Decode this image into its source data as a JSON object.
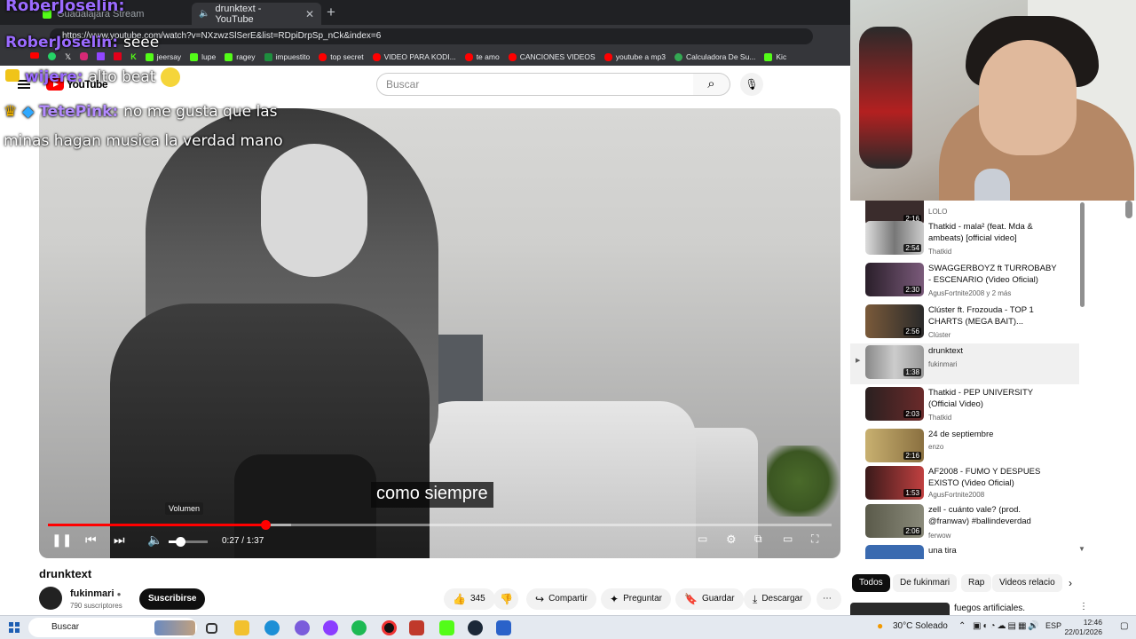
{
  "browser": {
    "tabs": [
      {
        "label": "Guadalajara Stream",
        "active": false
      },
      {
        "label": "drunktext - YouTube",
        "active": true
      }
    ],
    "url": "https://www.youtube.com/watch?v=NXzwzSlSerE&list=RDpiDrpSp_nCk&index=6",
    "bookmarks": [
      {
        "label": "jeersay",
        "color": "#15c39a"
      },
      {
        "label": "lupe",
        "color": "#15c39a"
      },
      {
        "label": "ragey",
        "color": "#15c39a"
      },
      {
        "label": "impuestito",
        "color": "#1e8e3e"
      },
      {
        "label": "top secret",
        "color": "#ff0000"
      },
      {
        "label": "VIDEO PARA KODI...",
        "color": "#ff0000"
      },
      {
        "label": "te amo",
        "color": "#ff0000"
      },
      {
        "label": "CANCIONES VIDEOS",
        "color": "#ff0000"
      },
      {
        "label": "youtube a mp3",
        "color": "#ff0000"
      },
      {
        "label": "Calculadora De Su...",
        "color": "#34a853"
      },
      {
        "label": "Kic",
        "color": "#53fc18"
      }
    ]
  },
  "youtube": {
    "logo": "YouTube",
    "search_placeholder": "Buscar"
  },
  "player": {
    "caption": "como siempre",
    "volume_tooltip": "Volumen",
    "current_time": "0:27",
    "duration": "1:37",
    "time_display": "0:27 / 1:37",
    "progress_fraction": 0.278,
    "volume_fraction": 0.3
  },
  "chat_overlay": [
    {
      "user": "RoberJoselin:",
      "message": ""
    },
    {
      "user": "RoberJoselin:",
      "message": "seee"
    },
    {
      "user": "wijere:",
      "message": "alto beat"
    },
    {
      "user": "TetePink:",
      "message": "no me gusta que las"
    },
    {
      "user": "",
      "message": "minas hagan musica la verdad mano"
    }
  ],
  "video_info": {
    "title": "drunktext",
    "channel": "fukinmari",
    "subscribers": "790 suscriptores",
    "subscribe_label": "Suscribirse",
    "likes": "345",
    "share_label": "Compartir",
    "ask_label": "Preguntar",
    "save_label": "Guardar",
    "download_label": "Descargar"
  },
  "playlist": [
    {
      "title": "",
      "channel": "LOLO",
      "duration": "2:16",
      "current": false
    },
    {
      "title": "Thatkid - mala² (feat. Mda & ambeats) [official video]",
      "channel": "Thatkid",
      "duration": "2:54",
      "current": false
    },
    {
      "title": "SWAGGERBOYZ ft TURROBABY - ESCENARIO (Video Oficial)",
      "channel": "AgusFortnite2008 y 2 más",
      "duration": "2:30",
      "current": false
    },
    {
      "title": "Clúster ft. Frozouda - TOP 1 CHARTS (MEGA BAIT)...",
      "channel": "Clúster",
      "duration": "2:56",
      "current": false
    },
    {
      "title": "drunktext",
      "channel": "fukinmari",
      "duration": "1:38",
      "current": true
    },
    {
      "title": "Thatkid - PEP UNIVERSITY (Official Video)",
      "channel": "Thatkid",
      "duration": "2:03",
      "current": false
    },
    {
      "title": "24 de septiembre",
      "channel": "enzo",
      "duration": "2:16",
      "current": false
    },
    {
      "title": "AF2008 - FUMO Y DESPUES EXISTO (Video Oficial)",
      "channel": "AgusFortnite2008",
      "duration": "1:53",
      "current": false
    },
    {
      "title": "zell - cuánto vale? (prod. @franwav) #ballindeverdad",
      "channel": "ferwow",
      "duration": "2:06",
      "current": false
    },
    {
      "title": "una tira",
      "channel": "",
      "duration": "",
      "current": false
    }
  ],
  "chips": [
    {
      "label": "Todos",
      "selected": true
    },
    {
      "label": "De fukinmari",
      "selected": false
    },
    {
      "label": "Rap",
      "selected": false
    },
    {
      "label": "Videos relacio",
      "selected": false
    }
  ],
  "next_video": {
    "title": "fuegos artificiales."
  },
  "taskbar": {
    "search_label": "Buscar",
    "weather": "30°C  Soleado",
    "language": "ESP",
    "time": "12:46",
    "date": "22/01/2026"
  }
}
